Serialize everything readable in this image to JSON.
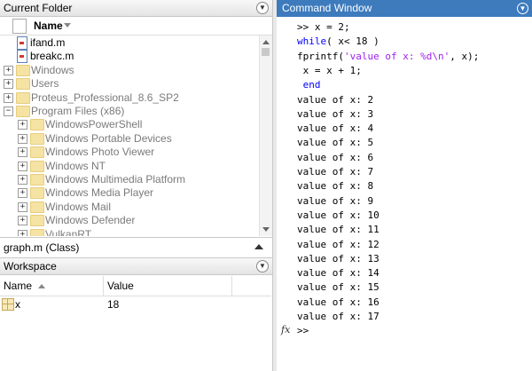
{
  "current_folder": {
    "title": "Current Folder",
    "column_name": "Name",
    "items": [
      {
        "label": "ifand.m",
        "type": "file",
        "indent": 0
      },
      {
        "label": "breakc.m",
        "type": "file",
        "indent": 0
      },
      {
        "label": "Windows",
        "type": "folder",
        "expander": "+",
        "indent": 0
      },
      {
        "label": "Users",
        "type": "folder",
        "expander": "+",
        "indent": 0
      },
      {
        "label": "Proteus_Professional_8.6_SP2",
        "type": "folder",
        "expander": "+",
        "indent": 0
      },
      {
        "label": "Program Files (x86)",
        "type": "folder",
        "expander": "-",
        "indent": 0
      },
      {
        "label": "WindowsPowerShell",
        "type": "folder",
        "expander": "+",
        "indent": 1
      },
      {
        "label": "Windows Portable Devices",
        "type": "folder",
        "expander": "+",
        "indent": 1
      },
      {
        "label": "Windows Photo Viewer",
        "type": "folder",
        "expander": "+",
        "indent": 1
      },
      {
        "label": "Windows NT",
        "type": "folder",
        "expander": "+",
        "indent": 1
      },
      {
        "label": "Windows Multimedia Platform",
        "type": "folder",
        "expander": "+",
        "indent": 1
      },
      {
        "label": "Windows Media Player",
        "type": "folder",
        "expander": "+",
        "indent": 1
      },
      {
        "label": "Windows Mail",
        "type": "folder",
        "expander": "+",
        "indent": 1
      },
      {
        "label": "Windows Defender",
        "type": "folder",
        "expander": "+",
        "indent": 1
      },
      {
        "label": "VulkanRT",
        "type": "folder",
        "expander": "+",
        "indent": 1
      }
    ]
  },
  "details": {
    "title": "graph.m  (Class)"
  },
  "workspace": {
    "title": "Workspace",
    "col_name": "Name",
    "col_value": "Value",
    "rows": [
      {
        "name": "x",
        "value": "18"
      }
    ]
  },
  "command_window": {
    "title": "Command Window",
    "code_lines": [
      {
        "parts": [
          {
            "t": ">> ",
            "c": "plain"
          },
          {
            "t": "x = 2;",
            "c": "plain"
          }
        ]
      },
      {
        "parts": [
          {
            "t": "while",
            "c": "kw"
          },
          {
            "t": "( x< 18 )",
            "c": "plain"
          }
        ]
      },
      {
        "parts": [
          {
            "t": "fprintf(",
            "c": "plain"
          },
          {
            "t": "'value of x: %d\\n'",
            "c": "str"
          },
          {
            "t": ", x);",
            "c": "plain"
          }
        ]
      },
      {
        "parts": [
          {
            "t": " x = x + 1;",
            "c": "plain"
          }
        ]
      },
      {
        "parts": [
          {
            "t": " end",
            "c": "kw"
          }
        ]
      }
    ],
    "output_lines": [
      "value of x: 2",
      "value of x: 3",
      "value of x: 4",
      "value of x: 5",
      "value of x: 6",
      "value of x: 7",
      "value of x: 8",
      "value of x: 9",
      "value of x: 10",
      "value of x: 11",
      "value of x: 12",
      "value of x: 13",
      "value of x: 14",
      "value of x: 15",
      "value of x: 16",
      "value of x: 17"
    ],
    "prompt": ">>",
    "fx_label": "fx"
  },
  "colors": {
    "header_blue": "#3d7bbd",
    "keyword": "#0000ff",
    "string": "#a020f0"
  }
}
